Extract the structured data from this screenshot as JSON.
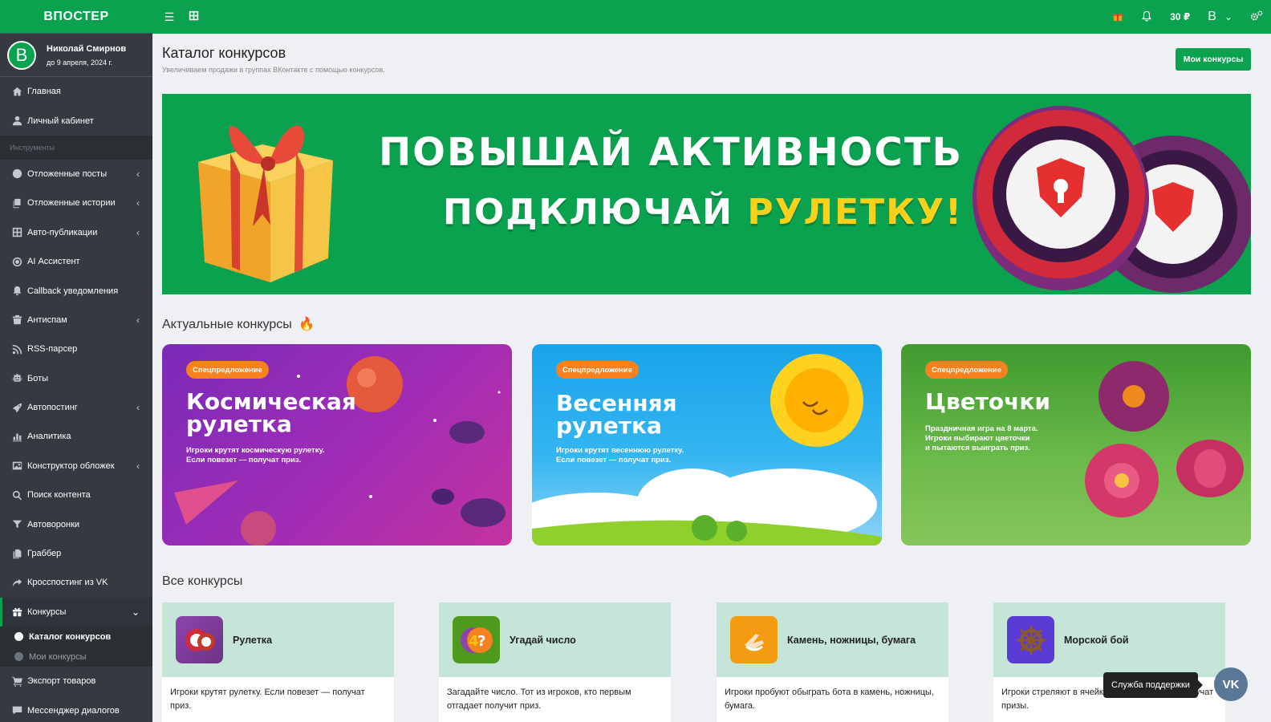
{
  "brand": "ВПОСТЕР",
  "user": {
    "initial": "B",
    "name": "Николай Смирнов",
    "until": "до 9 апреля, 2024 г."
  },
  "nav": {
    "home": "Главная",
    "cabinet": "Личный кабинет",
    "tools_header": "Инструменты",
    "items": [
      "Отложенные посты",
      "Отложенные истории",
      "Авто-публикации",
      "AI Ассистент",
      "Callback уведомления",
      "Антиспам",
      "RSS-парсер",
      "Боты",
      "Автопостинг",
      "Аналитика",
      "Конструктор обложек",
      "Поиск контента",
      "Автоворонки",
      "Граббер",
      "Кросспостинг из VK"
    ],
    "contests": "Конкурсы",
    "contests_sub": [
      "Каталог конкурсов",
      "Мои конкурсы"
    ],
    "export": "Экспорт товаров",
    "messenger": "Мессенджер диалогов"
  },
  "topbar": {
    "balance": "30 ₽",
    "account_initial": "B"
  },
  "page": {
    "title": "Каталог конкурсов",
    "subtitle": "Увеличиваем продажи в группах ВКонтакте с помощью конкурсов.",
    "my_contests_button": "Мои конкурсы"
  },
  "banner": {
    "line1": "ПОВЫШАЙ АКТИВНОСТЬ",
    "line2a": "ПОДКЛЮЧАЙ ",
    "line2b": "РУЛЕТКУ!"
  },
  "sections": {
    "current": "Актуальные конкурсы",
    "all": "Все конкурсы"
  },
  "promos": [
    {
      "badge": "Спецпредложение",
      "title_l1": "Космическая",
      "title_l2": "рулетка",
      "desc": "Игроки крутят космическую рулетку.\nЕсли повезет — получат приз."
    },
    {
      "badge": "Спецпредложение",
      "title_l1": "Весенняя",
      "title_l2": "рулетка",
      "desc": "Игроки крутят весеннюю рулетку.\nЕсли повезет — получат приз."
    },
    {
      "badge": "Спецпредложение",
      "title_l1": "Цветочки",
      "desc": "Праздничная игра на 8 марта.\nИгроки выбирают цветочки\nи пытаются выиграть приз."
    }
  ],
  "contests": [
    {
      "name": "Рулетка",
      "desc": "Игроки крутят рулетку. Если повезет — получат приз."
    },
    {
      "name": "Угадай число",
      "desc": "Загадайте число. Тот из игроков, кто первым отгадает получит приз."
    },
    {
      "name": "Камень, ножницы, бумага",
      "desc": "Игроки пробуют обыграть бота в камень, ножницы, бумага."
    },
    {
      "name": "Морской бой",
      "desc": "Игроки стреляют в ячейки. Если повезет — получат призы."
    }
  ],
  "support": {
    "label": "Служба поддержки",
    "vk": "VK"
  },
  "colors": {
    "accent": "#0aa14f",
    "sidebar": "#343a40",
    "badge": "#f5821f"
  }
}
